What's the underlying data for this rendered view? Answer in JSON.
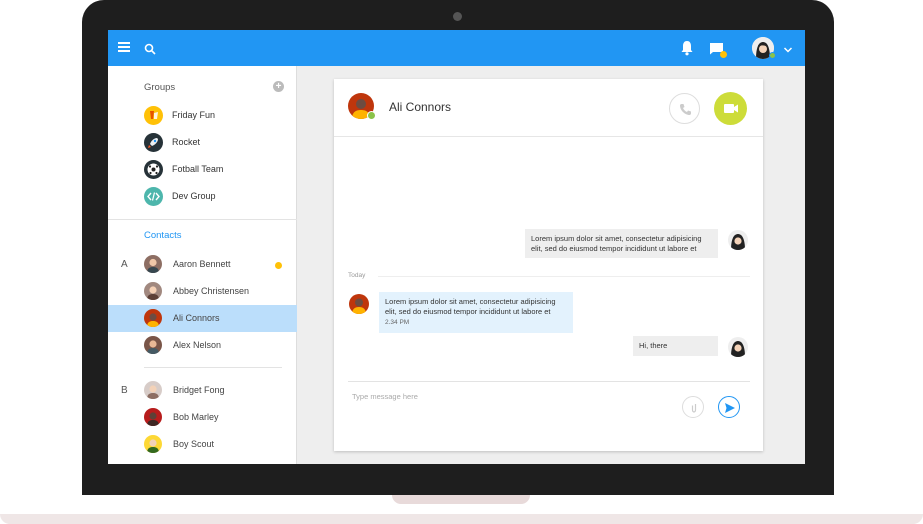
{
  "topbar": {
    "accent": "#2196f3"
  },
  "sidebar": {
    "groups_title": "Groups",
    "groups": [
      {
        "label": "Friday Fun",
        "icon": "drink-icon",
        "color": "#ffc107"
      },
      {
        "label": "Rocket",
        "icon": "rocket-icon",
        "color": "#263238"
      },
      {
        "label": "Fotball Team",
        "icon": "soccer-ball-icon",
        "color": "#263238"
      },
      {
        "label": "Dev Group",
        "icon": "code-icon",
        "color": "#4db6ac"
      }
    ],
    "contacts_title": "Contacts",
    "letters": {
      "a": "A",
      "b": "B"
    },
    "contacts": [
      {
        "label": "Aaron Bennett"
      },
      {
        "label": "Abbey Christensen"
      },
      {
        "label": "Ali Connors"
      },
      {
        "label": "Alex Nelson"
      },
      {
        "label": "Bridget Fong"
      },
      {
        "label": "Bob Marley"
      },
      {
        "label": "Boy Scout"
      }
    ]
  },
  "chat": {
    "name": "Ali Connors",
    "messages": [
      {
        "text": "Lorem ipsum dolor sit amet, consectetur adipisicing elit, sed do eiusmod tempor incididunt ut labore et"
      },
      {
        "text": "Lorem ipsum dolor sit amet, consectetur adipisicing elit, sed do eiusmod tempor incididunt ut labore et",
        "time": "2.34 PM"
      },
      {
        "text": "Hi, there"
      }
    ],
    "divider_label": "Today",
    "input_placeholder": "Type message here",
    "accent_call": "#cddc39"
  }
}
